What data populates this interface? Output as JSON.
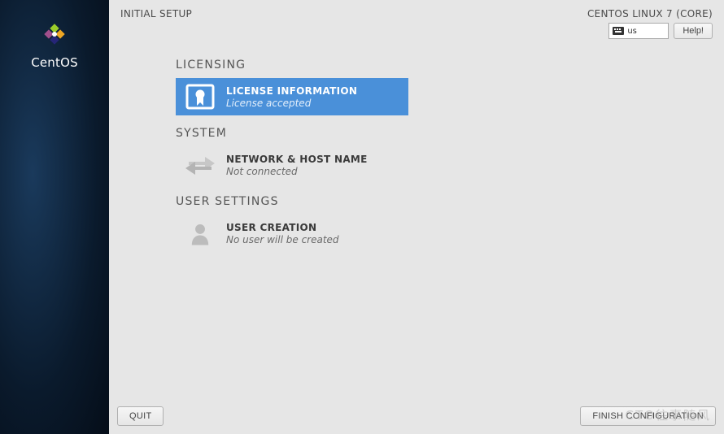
{
  "sidebar": {
    "brand": "CentOS"
  },
  "header": {
    "title": "INITIAL SETUP",
    "distro": "CENTOS LINUX 7 (CORE)",
    "keyboard_layout": "us",
    "help_label": "Help!"
  },
  "sections": {
    "licensing": {
      "heading": "LICENSING",
      "spoke": {
        "title": "LICENSE INFORMATION",
        "status": "License accepted"
      }
    },
    "system": {
      "heading": "SYSTEM",
      "spoke": {
        "title": "NETWORK & HOST NAME",
        "status": "Not connected"
      }
    },
    "user_settings": {
      "heading": "USER SETTINGS",
      "spoke": {
        "title": "USER CREATION",
        "status": "No user will be created"
      }
    }
  },
  "footer": {
    "quit_label": "QUIT",
    "finish_label": "FINISH CONFIGURATION"
  },
  "watermark": "CTO往事随风"
}
